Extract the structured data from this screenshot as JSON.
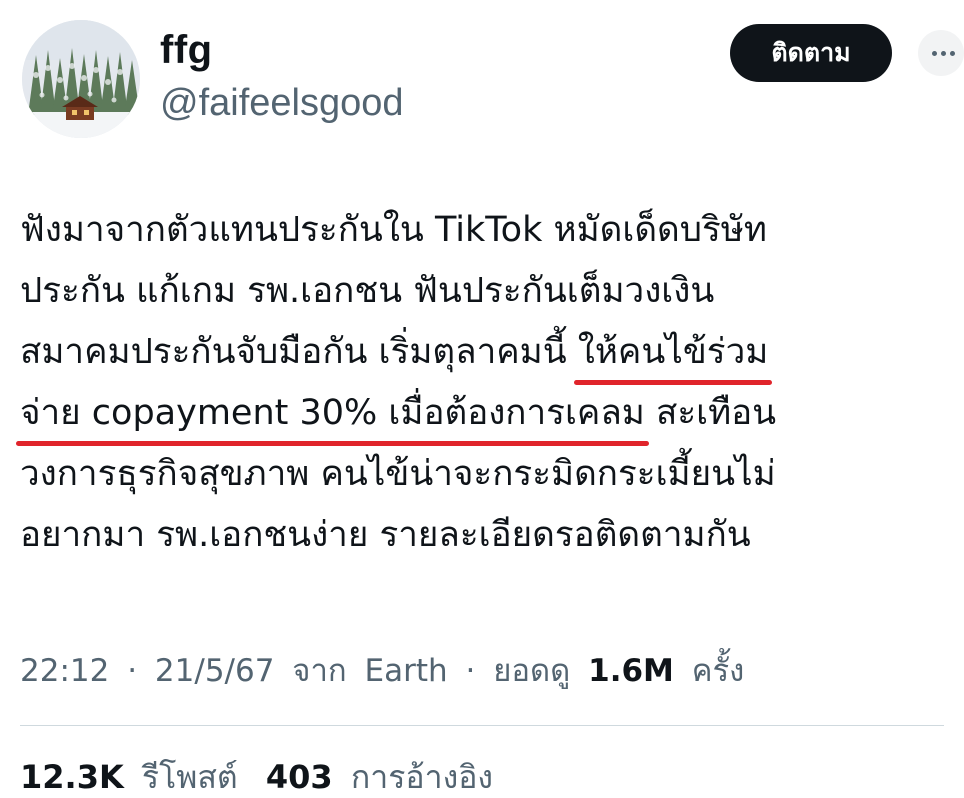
{
  "profile": {
    "display_name": "ffg",
    "handle": "@faifeelsgood",
    "avatar_icon": "snowy-forest-cabin-avatar"
  },
  "header": {
    "follow_label": "ติดตาม",
    "more_icon": "more-options-icon"
  },
  "tweet": {
    "lines": [
      [
        {
          "text": "ฟังมาจากตัวแทนประกันใน TikTok หมัดเด็ดบริษัท",
          "highlight": false
        }
      ],
      [
        {
          "text": "ประกัน แก้เกม รพ.เอกชน ฟันประกันเต็มวงเงิน",
          "highlight": false
        }
      ],
      [
        {
          "text": "สมาคมประกันจับมือกัน เริ่มตุลาคมนี้ ",
          "highlight": false
        },
        {
          "text": "ให้คนไข้ร่วม",
          "highlight": true
        }
      ],
      [
        {
          "text": "จ่าย copayment 30% เมื่อต้องการเคลม",
          "highlight": true
        },
        {
          "text": " สะเทือน",
          "highlight": false
        }
      ],
      [
        {
          "text": "วงการธุรกิจสุขภาพ คนไข้น่าจะกระมิดกระเมี้ยนไม่",
          "highlight": false
        }
      ],
      [
        {
          "text": "อยากมา รพ.เอกชนง่าย รายละเอียดรอติดตามกัน",
          "highlight": false
        }
      ]
    ],
    "highlight_color": "#e0242b"
  },
  "meta": {
    "time": "22:12",
    "date": "21/5/67",
    "source_prefix": "จาก",
    "source": "Earth",
    "views_prefix": "ยอดดู",
    "views_count": "1.6M",
    "views_suffix": "ครั้ง",
    "separator": "·"
  },
  "stats": {
    "retweets_count": "12.3K",
    "retweets_label": "รีโพสต์",
    "quotes_count": "403",
    "quotes_label": "การอ้างอิง"
  }
}
